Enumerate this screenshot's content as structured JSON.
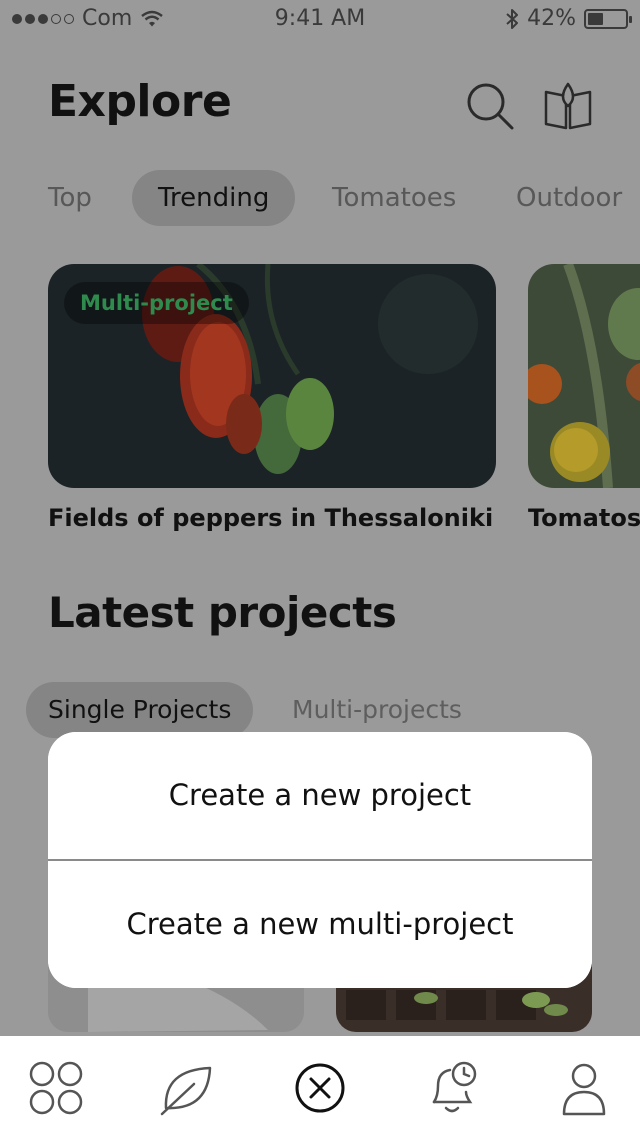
{
  "status_bar": {
    "carrier": "Com",
    "time": "9:41 AM",
    "battery": "42%",
    "battery_level": 0.42
  },
  "header": {
    "title": "Explore",
    "icons": [
      "search-icon",
      "book-leaf-icon"
    ]
  },
  "tabs": [
    {
      "label": "Top",
      "active": false
    },
    {
      "label": "Trending",
      "active": true
    },
    {
      "label": "Tomatoes",
      "active": false
    },
    {
      "label": "Outdoor",
      "active": false
    }
  ],
  "cards": [
    {
      "badge": "Multi-project",
      "title": "Fields of peppers in Thessaloniki"
    },
    {
      "title": "Tomatos"
    }
  ],
  "latest": {
    "title": "Latest projects",
    "tabs": [
      {
        "label": "Single Projects",
        "active": true
      },
      {
        "label": "Multi-projects",
        "active": false
      }
    ]
  },
  "action_sheet": {
    "options": [
      "Create a new project",
      "Create a new multi-project"
    ]
  },
  "bottom_nav": {
    "items": [
      "grid-icon",
      "leaf-icon",
      "close-circle-icon",
      "bell-clock-icon",
      "profile-icon"
    ]
  },
  "colors": {
    "overlay_bg": "#9a9a9a",
    "badge_text": "#2f8a4e",
    "sheet_bg": "#ffffff"
  }
}
